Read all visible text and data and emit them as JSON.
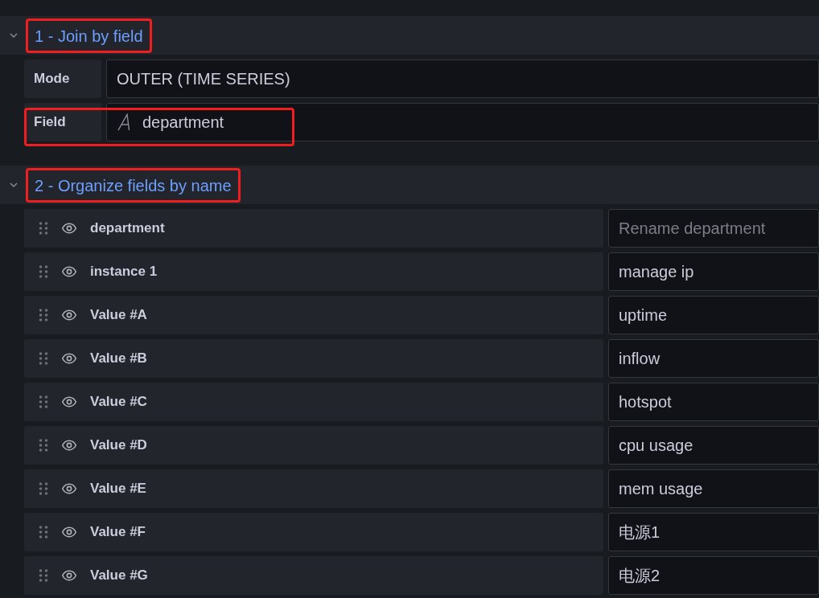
{
  "transformations": [
    {
      "title": "1 - Join by field",
      "expanded": true,
      "highlighted": true,
      "kind": "join",
      "options": [
        {
          "label": "Mode",
          "value": "OUTER (TIME SERIES)",
          "highlighted": false
        },
        {
          "label": "Field",
          "value": "department",
          "highlighted": true
        }
      ]
    },
    {
      "title": "2 - Organize fields by name",
      "expanded": true,
      "highlighted": true,
      "kind": "organize",
      "fields": [
        {
          "name": "department",
          "placeholder": "Rename department"
        },
        {
          "name": "instance 1",
          "value": "manage ip"
        },
        {
          "name": "Value #A",
          "value": "uptime"
        },
        {
          "name": "Value #B",
          "value": "inflow"
        },
        {
          "name": "Value #C",
          "value": "hotspot"
        },
        {
          "name": "Value #D",
          "value": "cpu usage"
        },
        {
          "name": "Value #E",
          "value": "mem usage"
        },
        {
          "name": "Value #F",
          "value": "电源1"
        },
        {
          "name": "Value #G",
          "value": "电源2"
        }
      ]
    }
  ]
}
